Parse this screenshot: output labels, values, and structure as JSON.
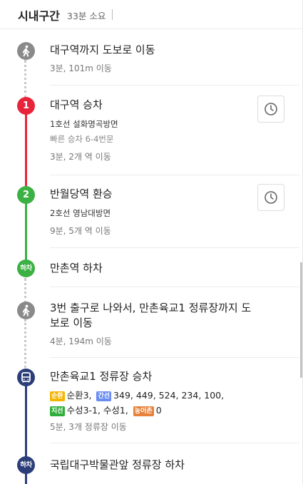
{
  "header": {
    "title": "시내구간",
    "duration": "33분 소요"
  },
  "colors": {
    "walk": "#8a8a8a",
    "line1": "#e8243a",
    "line2": "#3bb143",
    "bus": "#2c3e7a",
    "badge_sunhwan": "#f2b500",
    "badge_ganseon": "#6a8cf0",
    "badge_jiseon": "#2fae3b",
    "badge_nongeochon": "#e8813a"
  },
  "steps": [
    {
      "type": "walk",
      "icon": "walking-person-icon",
      "title": "대구역까지 도보로 이동",
      "meta": "3분, 101m 이동"
    },
    {
      "type": "board",
      "marker": "1",
      "title": "대구역 승차",
      "sub": "1호선 설화명곡방면",
      "note": "빠른 승차 6-4번문",
      "meta": "3분, 2개 역 이동"
    },
    {
      "type": "transfer",
      "marker": "2",
      "title": "반월당역 환승",
      "sub": "2호선 영남대방면",
      "meta": "9분, 5개 역 이동"
    },
    {
      "type": "alight",
      "marker": "하차",
      "title": "만촌역 하차"
    },
    {
      "type": "walk",
      "icon": "walking-person-icon",
      "title_line1": "3번 출구로 나와서, 만촌육교1 정류장까지 도",
      "title_line2": "보로 이동",
      "meta": "4분, 194m 이동"
    },
    {
      "type": "bus-board",
      "icon": "bus-icon",
      "title": "만촌육교1 정류장 승차",
      "badges": {
        "sunhwan": "순환",
        "ganseon": "간선",
        "jiseon": "지선",
        "nongeochon": "농어촌"
      },
      "routes_row1_a": "순환3,",
      "routes_row1_b": "349,  449,  524,  234,  100,",
      "routes_row2_a": "수성3-1,  수성1,",
      "routes_row2_b": "0",
      "meta": "5분, 3개 정류장 이동"
    },
    {
      "type": "bus-alight",
      "marker": "하차",
      "title": "국립대구박물관앞 정류장 하차"
    }
  ]
}
